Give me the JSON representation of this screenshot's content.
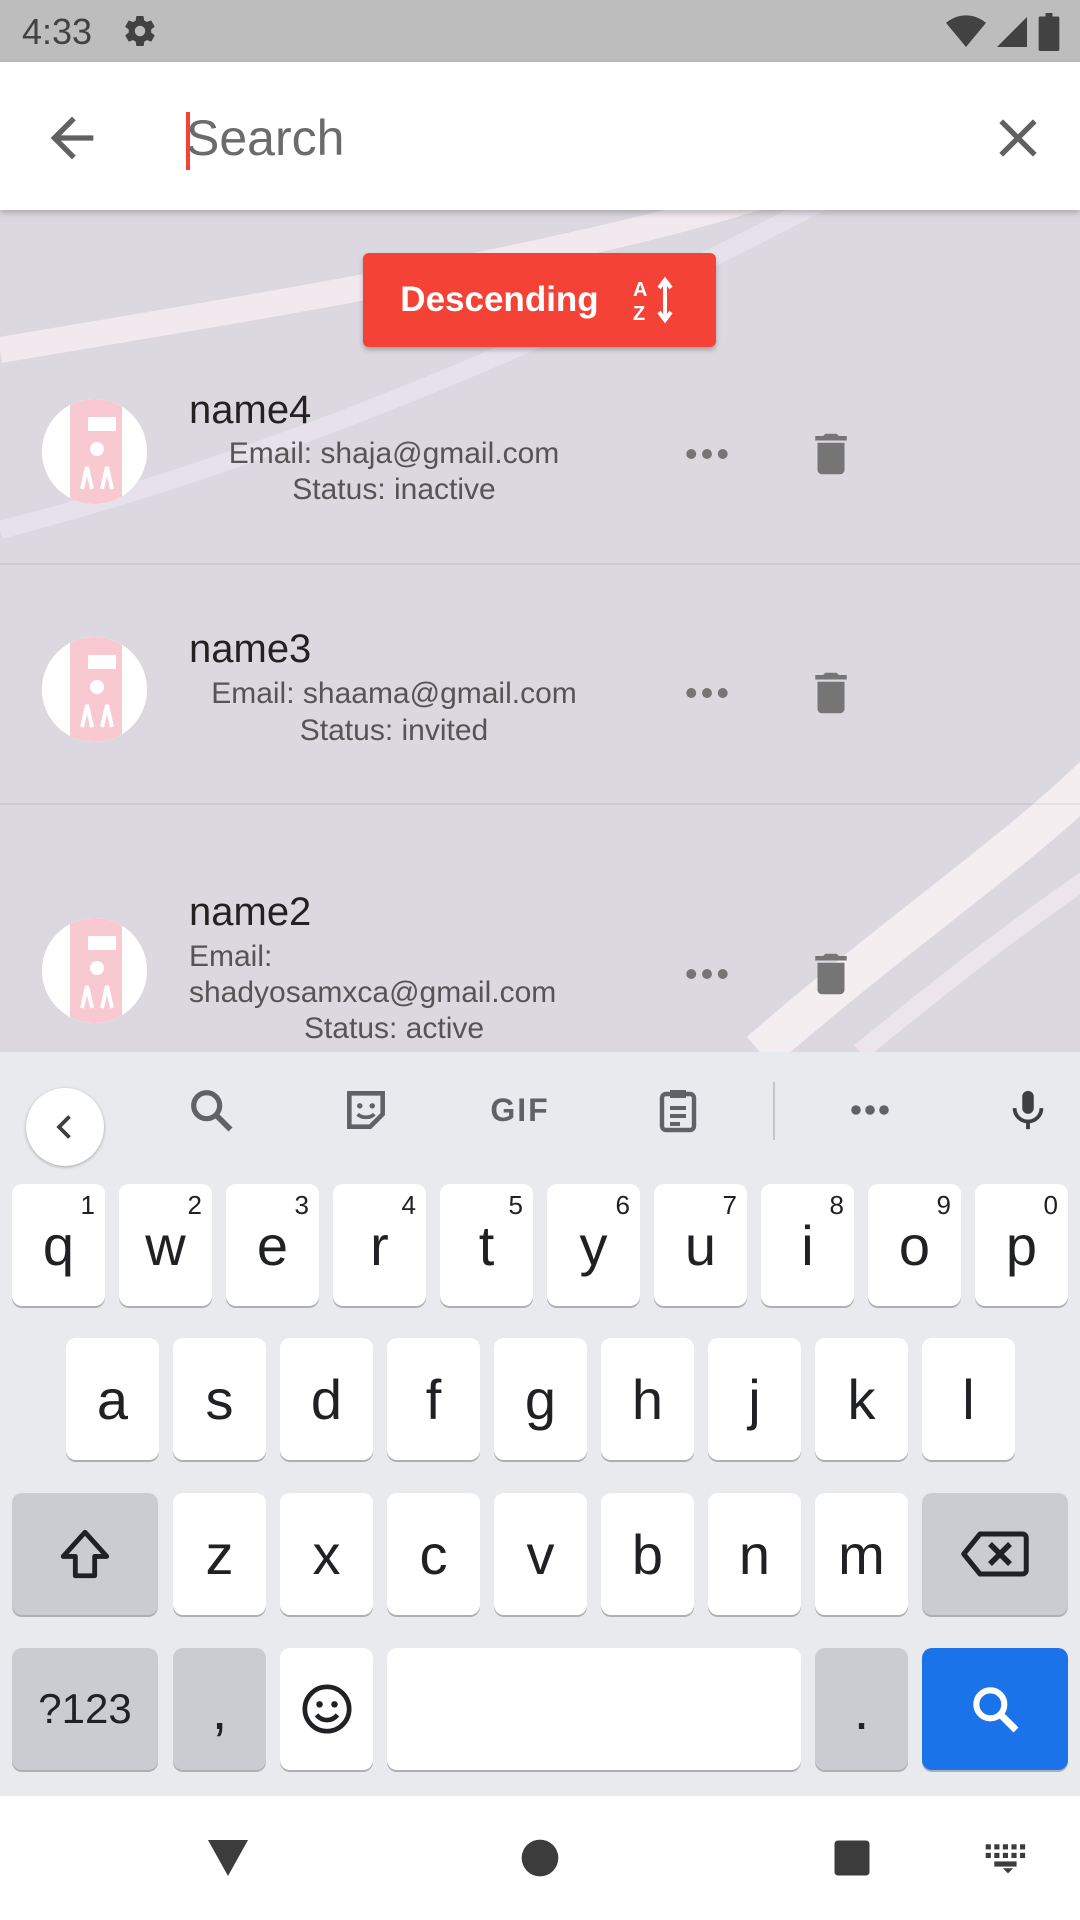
{
  "status_bar": {
    "time": "4:33"
  },
  "search": {
    "placeholder": "Search",
    "value": ""
  },
  "sort_button": {
    "label": "Descending"
  },
  "users": [
    {
      "name": "name4",
      "email": "Email: shaja@gmail.com",
      "status": "Status: inactive"
    },
    {
      "name": "name3",
      "email": "Email: shaama@gmail.com",
      "status": "Status: invited"
    },
    {
      "name": "name2",
      "email_label": "Email:",
      "email_value": "shadyosamxca@gmail.com",
      "status": "Status: active"
    }
  ],
  "keyboard": {
    "toolbar": {
      "gif_label": "GIF"
    },
    "row1": [
      {
        "key": "q",
        "hint": "1"
      },
      {
        "key": "w",
        "hint": "2"
      },
      {
        "key": "e",
        "hint": "3"
      },
      {
        "key": "r",
        "hint": "4"
      },
      {
        "key": "t",
        "hint": "5"
      },
      {
        "key": "y",
        "hint": "6"
      },
      {
        "key": "u",
        "hint": "7"
      },
      {
        "key": "i",
        "hint": "8"
      },
      {
        "key": "o",
        "hint": "9"
      },
      {
        "key": "p",
        "hint": "0"
      }
    ],
    "row2": [
      "a",
      "s",
      "d",
      "f",
      "g",
      "h",
      "j",
      "k",
      "l"
    ],
    "row3": [
      "z",
      "x",
      "c",
      "v",
      "b",
      "n",
      "m"
    ],
    "symbols_label": "?123",
    "comma": ",",
    "period": "."
  },
  "colors": {
    "accent": "#f44336",
    "keyboard_action": "#1a73e8",
    "content_bg": "#dcd8e0"
  }
}
